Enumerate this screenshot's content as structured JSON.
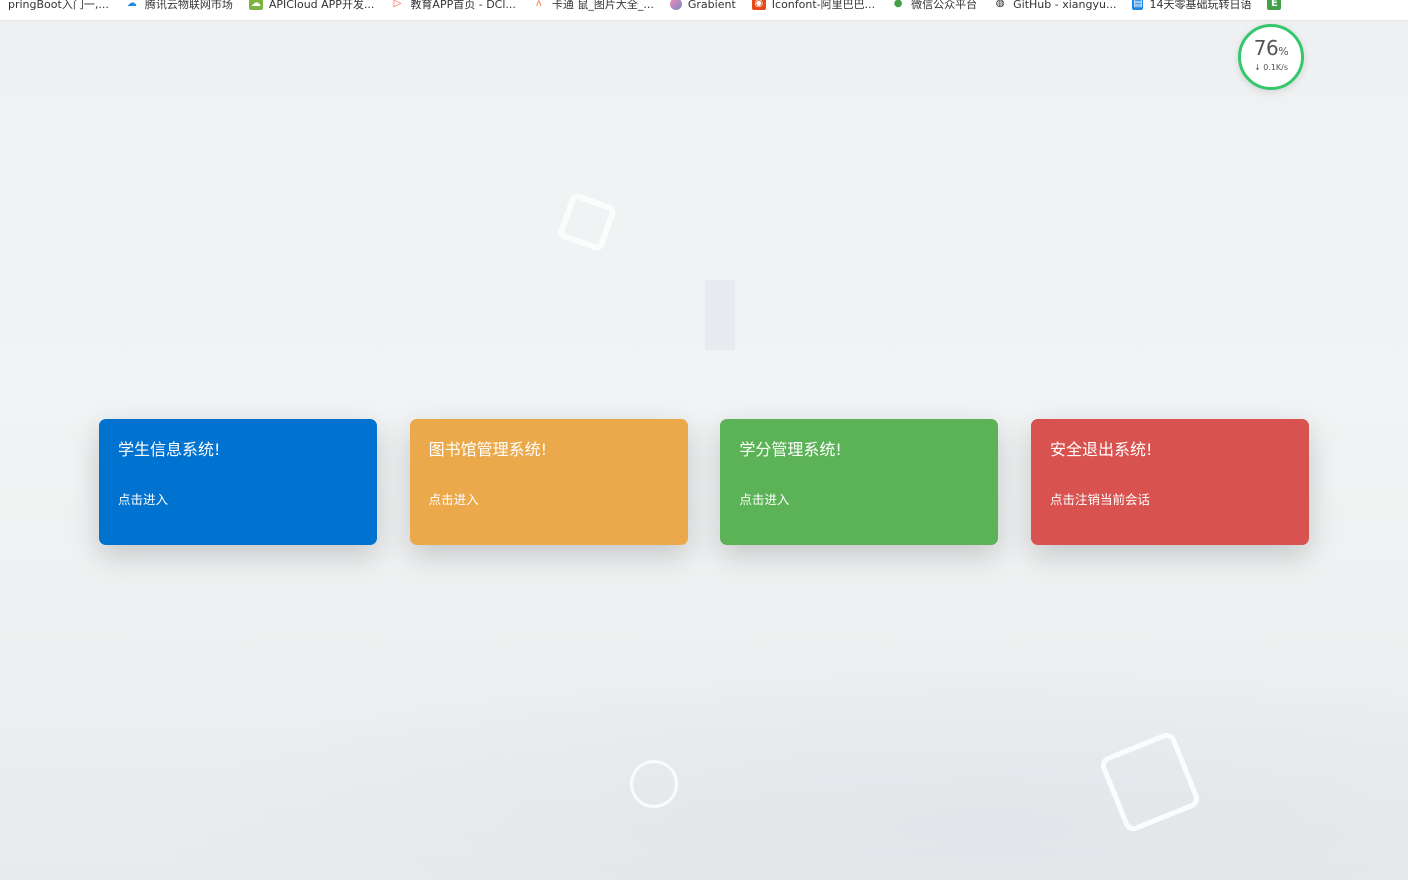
{
  "bookmarks": [
    {
      "label": "pringBoot入门一,...",
      "icon": "blank-icon",
      "color": "#888888"
    },
    {
      "label": "腾讯云物联网市场",
      "icon": "cloud-icon",
      "color": "#1e88e5"
    },
    {
      "label": "APICloud APP开发...",
      "icon": "apicloud-icon",
      "color": "#7cb342"
    },
    {
      "label": "教育APP首页 - DCl...",
      "icon": "play-icon",
      "color": "#f4511e"
    },
    {
      "label": "卡通 鼠_图片大全_...",
      "icon": "fox-icon",
      "color": "#ff7043"
    },
    {
      "label": "Grabient",
      "icon": "grabient-icon",
      "color": "#e57373"
    },
    {
      "label": "Iconfont-阿里巴巴...",
      "icon": "iconfont-icon",
      "color": "#e64a19"
    },
    {
      "label": "微信公众平台",
      "icon": "wechat-icon",
      "color": "#43a047"
    },
    {
      "label": "GitHub - xiangyu...",
      "icon": "github-icon",
      "color": "#222222"
    },
    {
      "label": "14天零基础玩转日语",
      "icon": "doc-icon",
      "color": "#1e88e5"
    },
    {
      "label": "",
      "icon": "e-icon",
      "color": "#43a047"
    }
  ],
  "speed": {
    "percent": "76",
    "unit": "%",
    "rate": "0.1K/s"
  },
  "cards": [
    {
      "title": "学生信息系统!",
      "subtitle": "点击进入",
      "color": "#0073d1"
    },
    {
      "title": "图书馆管理系统!",
      "subtitle": "点击进入",
      "color": "#eba94b"
    },
    {
      "title": "学分管理系统!",
      "subtitle": "点击进入",
      "color": "#5cb357"
    },
    {
      "title": "安全退出系统!",
      "subtitle": "点击注销当前会话",
      "color": "#d8534f"
    }
  ]
}
